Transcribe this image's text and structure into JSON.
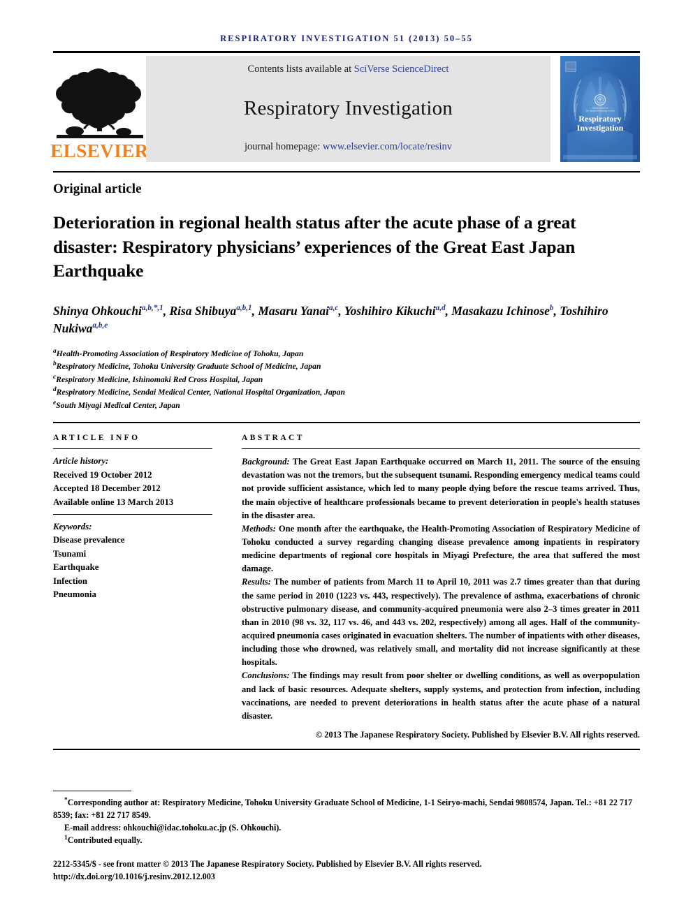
{
  "running_head": "Respiratory Investigation 51 (2013) 50–55",
  "masthead": {
    "publisher_logo_text": "ELSEVIER",
    "contents_prefix": "Contents lists available at ",
    "contents_link": "SciVerse ScienceDirect",
    "journal_title": "Respiratory Investigation",
    "homepage_prefix": "journal homepage: ",
    "homepage_link": "www.elsevier.com/locate/resinv",
    "cover": {
      "title_line1": "Respiratory",
      "title_line2": "Investigation",
      "society_line1": "Official Journal of",
      "society_line2": "The Japanese Respiratory Society",
      "background_color": "#2f68b4"
    }
  },
  "article_type": "Original article",
  "title": "Deterioration in regional health status after the acute phase of a great disaster: Respiratory physicians’ experiences of the Great East Japan Earthquake",
  "authors": [
    {
      "name": "Shinya Ohkouchi",
      "sup": "a,b,*,1",
      "sep": ", "
    },
    {
      "name": "Risa Shibuya",
      "sup": "a,b,1",
      "sep": ", "
    },
    {
      "name": "Masaru Yanai",
      "sup": "a,c",
      "sep": ", "
    },
    {
      "name": "Yoshihiro Kikuchi",
      "sup": "a,d",
      "sep": ", "
    },
    {
      "name": "Masakazu Ichinose",
      "sup": "b",
      "sep": ", "
    },
    {
      "name": "Toshihiro Nukiwa",
      "sup": "a,b,e",
      "sep": ""
    }
  ],
  "affiliations": [
    {
      "marker": "a",
      "text": "Health-Promoting Association of Respiratory Medicine of Tohoku, Japan"
    },
    {
      "marker": "b",
      "text": "Respiratory Medicine, Tohoku University Graduate School of Medicine, Japan"
    },
    {
      "marker": "c",
      "text": "Respiratory Medicine, Ishinomaki Red Cross Hospital, Japan"
    },
    {
      "marker": "d",
      "text": "Respiratory Medicine, Sendai Medical Center, National Hospital Organization, Japan"
    },
    {
      "marker": "e",
      "text": "South Miyagi Medical Center, Japan"
    }
  ],
  "article_info": {
    "heading": "Article info",
    "history_label": "Article history:",
    "history": [
      "Received 19 October 2012",
      "Accepted 18 December 2012",
      "Available online 13 March 2013"
    ],
    "keywords_label": "Keywords:",
    "keywords": [
      "Disease prevalence",
      "Tsunami",
      "Earthquake",
      "Infection",
      "Pneumonia"
    ]
  },
  "abstract": {
    "heading": "Abstract",
    "sections": [
      {
        "label": "Background:",
        "text": " The Great East Japan Earthquake occurred on March 11, 2011. The source of the ensuing devastation was not the tremors, but the subsequent tsunami. Responding emergency medical teams could not provide sufficient assistance, which led to many people dying before the rescue teams arrived. Thus, the main objective of healthcare professionals became to prevent deterioration in people's health statuses in the disaster area."
      },
      {
        "label": "Methods:",
        "text": " One month after the earthquake, the Health-Promoting Association of Respiratory Medicine of Tohoku conducted a survey regarding changing disease prevalence among inpatients in respiratory medicine departments of regional core hospitals in Miyagi Prefecture, the area that suffered the most damage."
      },
      {
        "label": "Results:",
        "text": " The number of patients from March 11 to April 10, 2011 was 2.7 times greater than that during the same period in 2010 (1223 vs. 443, respectively). The prevalence of asthma, exacerbations of chronic obstructive pulmonary disease, and community-acquired pneumonia were also 2–3 times greater in 2011 than in 2010 (98 vs. 32, 117 vs. 46, and 443 vs. 202, respectively) among all ages. Half of the community-acquired pneumonia cases originated in evacuation shelters. The number of inpatients with other diseases, including those who drowned, was relatively small, and mortality did not increase significantly at these hospitals."
      },
      {
        "label": "Conclusions:",
        "text": " The findings may result from poor shelter or dwelling conditions, as well as overpopulation and lack of basic resources. Adequate shelters, supply systems, and protection from infection, including vaccinations, are needed to prevent deteriorations in health status after the acute phase of a natural disaster."
      }
    ],
    "copyright": "© 2013 The Japanese Respiratory Society. Published by Elsevier B.V. All rights reserved."
  },
  "footnotes": {
    "corresponding": "Corresponding author at: Respiratory Medicine, Tohoku University Graduate School of Medicine, 1-1 Seiryo-machi, Sendai 9808574, Japan. Tel.: +81 22 717 8539; fax: +81 22 717 8549.",
    "corresponding_marker": "*",
    "email_label": "E-mail address:",
    "email": "ohkouchi@idac.tohoku.ac.jp (S. Ohkouchi).",
    "contributed_marker": "1",
    "contributed": "Contributed equally."
  },
  "front_matter": {
    "line1": "2212-5345/$ - see front matter © 2013 The Japanese Respiratory Society. Published by Elsevier B.V. All rights reserved.",
    "doi": "http://dx.doi.org/10.1016/j.resinv.2012.12.003"
  }
}
